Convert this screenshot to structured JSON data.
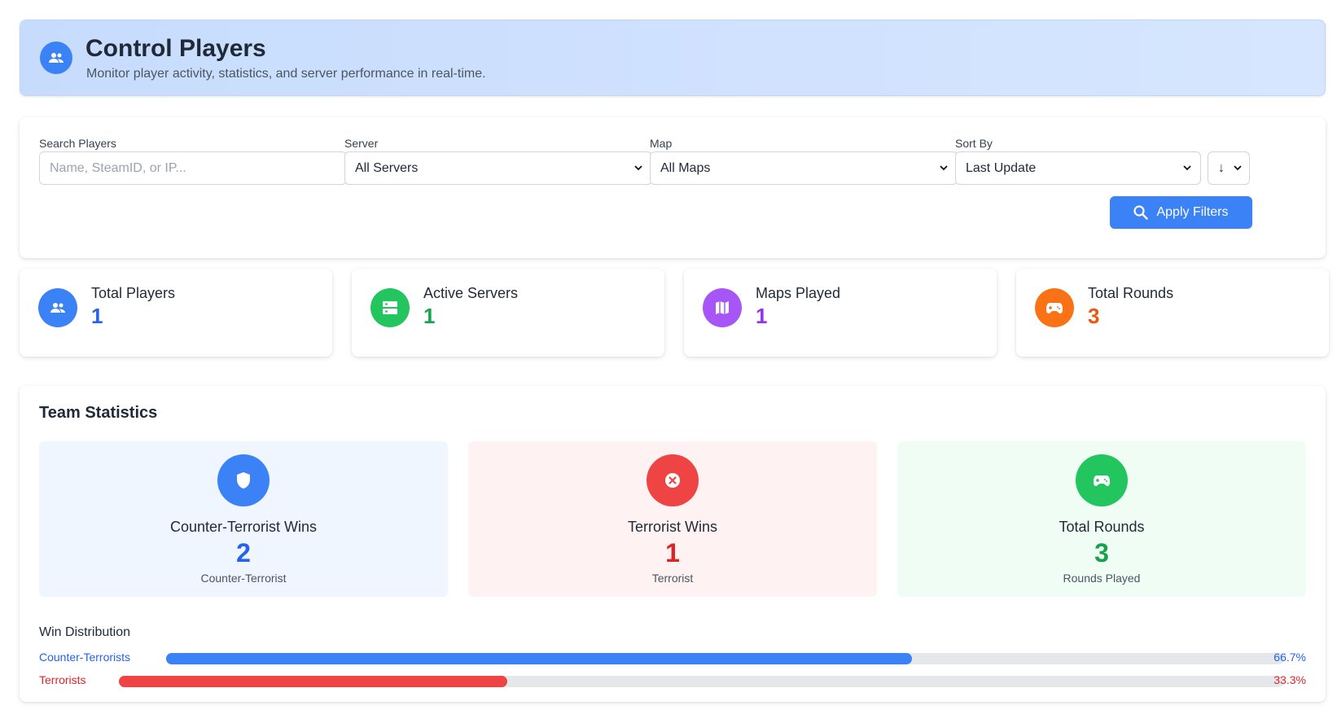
{
  "header": {
    "title": "Control Players",
    "subtitle": "Monitor player activity, statistics, and server performance in real-time.",
    "icon": "users-icon"
  },
  "filters": {
    "search_label": "Search Players",
    "search_placeholder": "Name, SteamID, or IP...",
    "server_label": "Server",
    "server_value": "All Servers",
    "map_label": "Map",
    "map_value": "All Maps",
    "sort_label": "Sort By",
    "sort_value": "Last Update",
    "sort_direction": "↓",
    "apply_label": "Apply Filters"
  },
  "stats": [
    {
      "label": "Total Players",
      "value": "1",
      "color": "#3b82f6",
      "value_color": "#2563eb",
      "icon": "users-icon"
    },
    {
      "label": "Active Servers",
      "value": "1",
      "color": "#22c55e",
      "value_color": "#16a34a",
      "icon": "server-icon"
    },
    {
      "label": "Maps Played",
      "value": "1",
      "color": "#a855f7",
      "value_color": "#9333ea",
      "icon": "map-icon"
    },
    {
      "label": "Total Rounds",
      "value": "3",
      "color": "#f97316",
      "value_color": "#ea580c",
      "icon": "gamepad-icon"
    }
  ],
  "team": {
    "title": "Team Statistics",
    "boxes": [
      {
        "name": "Counter-Terrorist Wins",
        "value": "2",
        "sub": "Counter-Terrorist",
        "bg": "#eff6ff",
        "icon_bg": "#3b82f6",
        "value_color": "#2563eb",
        "icon": "shield-icon"
      },
      {
        "name": "Terrorist Wins",
        "value": "1",
        "sub": "Terrorist",
        "bg": "#fef2f2",
        "icon_bg": "#ef4444",
        "value_color": "#dc2626",
        "icon": "x-circle-icon"
      },
      {
        "name": "Total Rounds",
        "value": "3",
        "sub": "Rounds Played",
        "bg": "#f0fdf4",
        "icon_bg": "#22c55e",
        "value_color": "#16a34a",
        "icon": "gamepad-icon"
      }
    ],
    "distribution": {
      "title": "Win Distribution",
      "rows": [
        {
          "label": "Counter-Terrorists",
          "pct_text": "66.7%",
          "fraction": 0.667,
          "color": "#3b82f6",
          "text_color": "#2563eb"
        },
        {
          "label": "Terrorists",
          "pct_text": "33.3%",
          "fraction": 0.333,
          "color": "#ef4444",
          "text_color": "#dc2626"
        }
      ]
    }
  }
}
